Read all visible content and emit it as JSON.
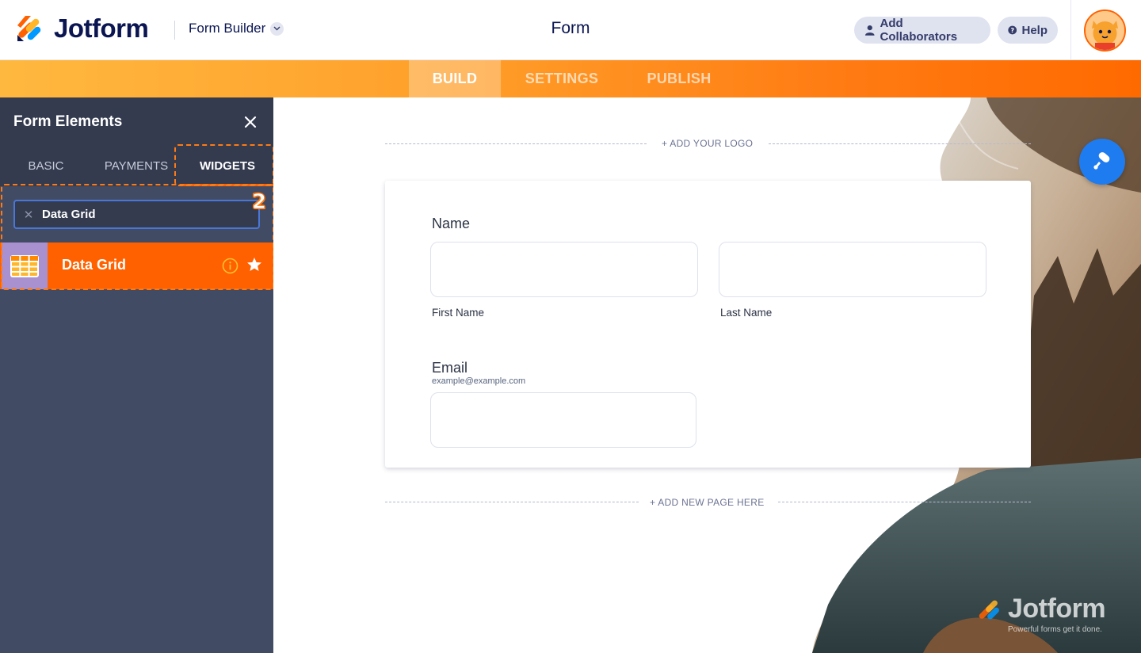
{
  "header": {
    "brand": "Jotform",
    "builder_label": "Form Builder",
    "form_title": "Form",
    "add_collaborators_label": "Add Collaborators",
    "help_label": "Help"
  },
  "build_tabs": {
    "build": "BUILD",
    "settings": "SETTINGS",
    "publish": "PUBLISH",
    "active": "BUILD"
  },
  "panel": {
    "title": "Form Elements",
    "tabs": [
      "BASIC",
      "PAYMENTS",
      "WIDGETS"
    ],
    "active_tab": "WIDGETS",
    "search_value": "Data Grid",
    "step_badge": "2",
    "results": [
      {
        "label": "Data Grid",
        "icon": "grid-table-icon"
      }
    ]
  },
  "canvas": {
    "add_logo": "+ ADD YOUR LOGO",
    "add_page": "+ ADD NEW PAGE HERE",
    "fields": {
      "name_label": "Name",
      "first_name_sub": "First Name",
      "last_name_sub": "Last Name",
      "email_label": "Email",
      "email_hint": "example@example.com"
    },
    "watermark_brand": "Jotform",
    "watermark_tagline": "Powerful forms get it done."
  },
  "colors": {
    "brand_orange": "#ff6100",
    "navy": "#0a1551",
    "panel_bg": "#424b64",
    "panel_head": "#343b4f",
    "accent_blue": "#1e7cf0",
    "widget_icon_bg": "#a991d0"
  }
}
